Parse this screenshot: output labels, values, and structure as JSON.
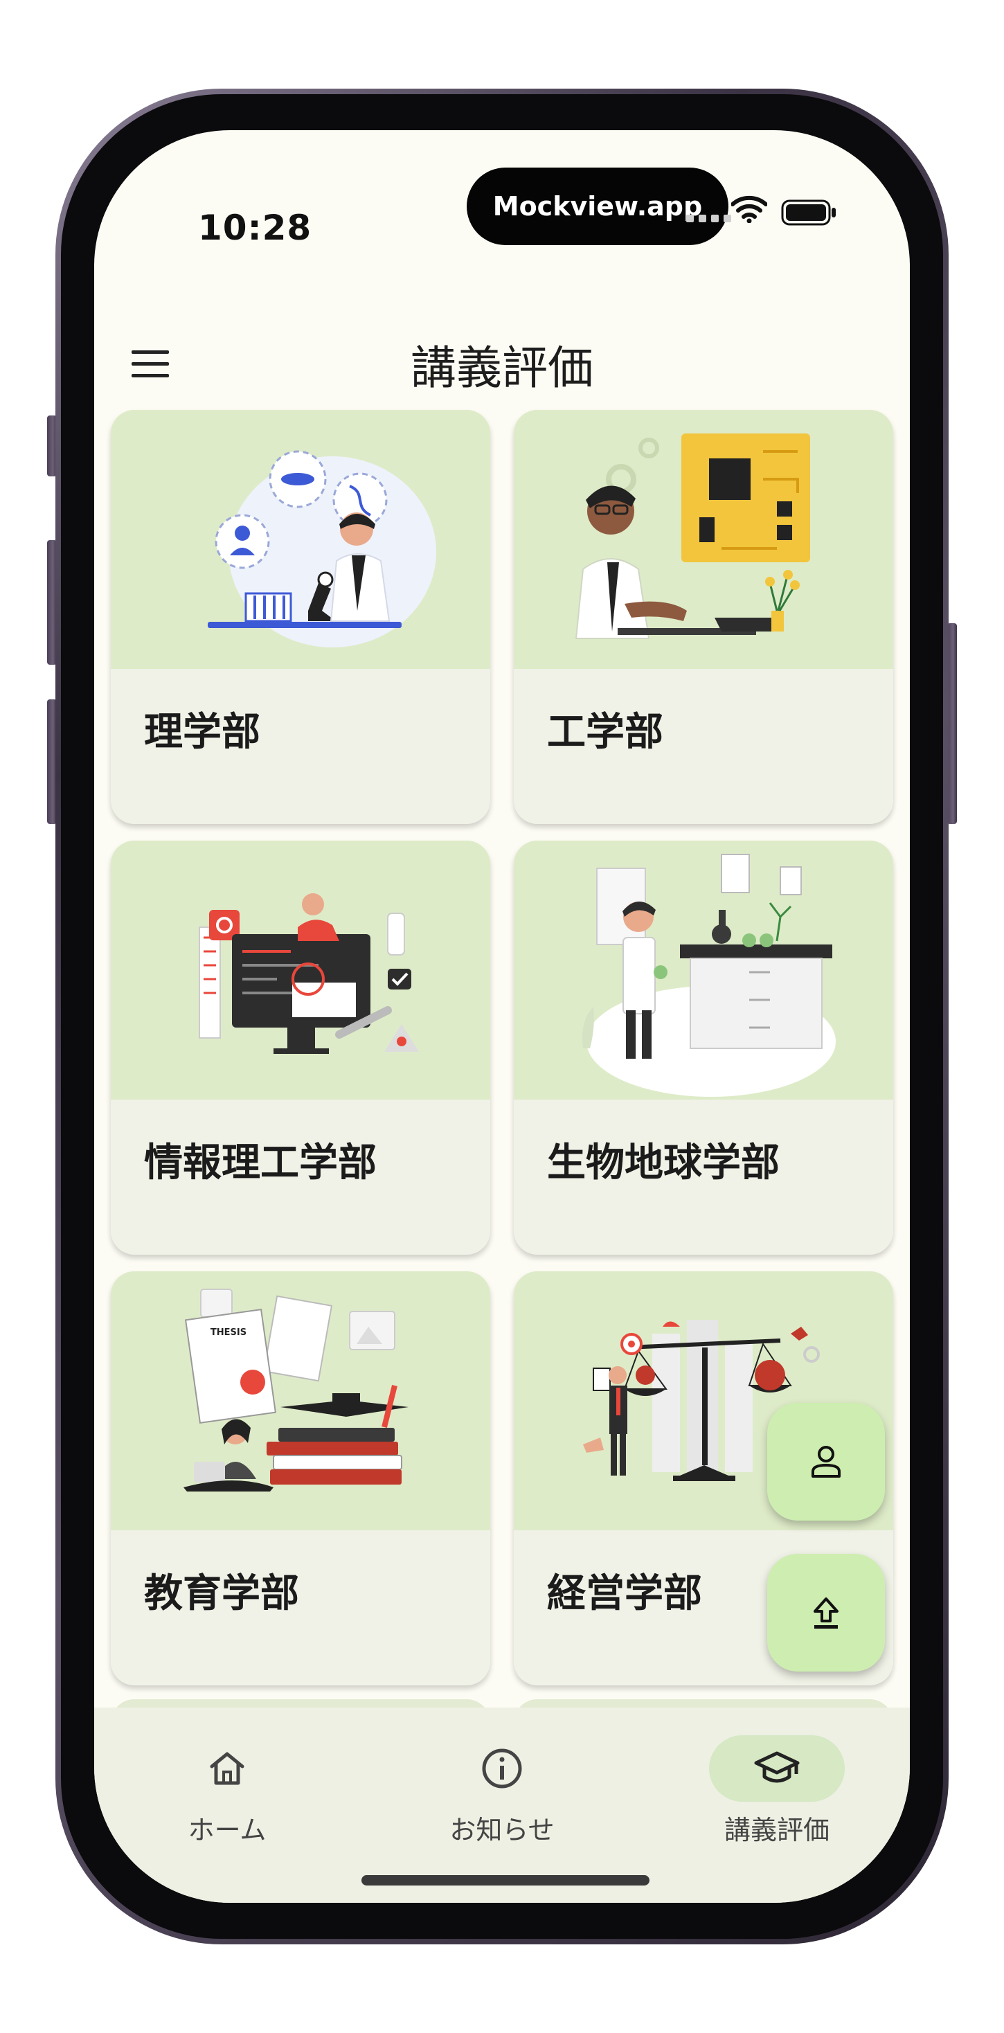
{
  "status_bar": {
    "time": "10:28",
    "island_text": "Mockview.app",
    "icons": [
      "signal-icon",
      "wifi-icon",
      "battery-icon"
    ]
  },
  "app_bar": {
    "title": "講義評価",
    "menu_icon": "menu-icon"
  },
  "faculties": [
    {
      "label": "理学部",
      "illustration": "scientist-microscope-illustration"
    },
    {
      "label": "工学部",
      "illustration": "engineer-circuit-board-illustration"
    },
    {
      "label": "情報理工学部",
      "illustration": "programmer-computer-illustration"
    },
    {
      "label": "生物地球学部",
      "illustration": "biologist-lab-illustration"
    },
    {
      "label": "教育学部",
      "illustration": "student-books-thesis-illustration"
    },
    {
      "label": "経営学部",
      "illustration": "business-scale-illustration"
    }
  ],
  "fabs": {
    "profile_icon": "person-icon",
    "upload_icon": "upload-icon"
  },
  "bottom_nav": {
    "items": [
      {
        "label": "ホーム",
        "icon": "home-icon",
        "active": false
      },
      {
        "label": "お知らせ",
        "icon": "info-icon",
        "active": false
      },
      {
        "label": "講義評価",
        "icon": "graduation-cap-icon",
        "active": true
      }
    ]
  },
  "colors": {
    "screen_bg": "#fdfcf4",
    "card_image_bg": "#deebc8",
    "card_body_bg": "#f0f2e7",
    "fab_bg": "#cdeeb0",
    "nav_bg": "#eef0e3",
    "nav_active_pill": "#d6e8c4"
  }
}
